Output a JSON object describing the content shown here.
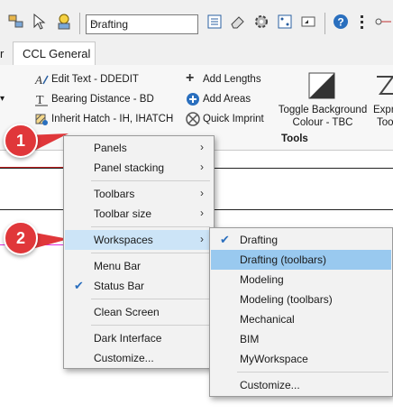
{
  "toolbar": {
    "workspace_value": "Drafting"
  },
  "tabs": [
    {
      "label": "r"
    },
    {
      "label": "CCL General"
    }
  ],
  "ribbon": {
    "col1": [
      "Edit Text - DDEDIT",
      "Bearing Distance - BD",
      "Inherit Hatch - IH, IHATCH"
    ],
    "col2": [
      "Add Lengths",
      "Add Areas",
      "Quick Imprint"
    ],
    "toggle_label_1": "Toggle Background",
    "toggle_label_2": "Colour - TBC",
    "expr_label_1": "Expr",
    "expr_label_2": "Too",
    "group_label": "Tools"
  },
  "callouts": [
    "1",
    "2"
  ],
  "context_menu": {
    "items": [
      {
        "label": "Panels",
        "submenu": true
      },
      {
        "label": "Panel stacking",
        "submenu": true
      },
      {
        "label": "Toolbars",
        "submenu": true
      },
      {
        "label": "Toolbar size",
        "submenu": true
      },
      {
        "label": "Workspaces",
        "submenu": true
      },
      {
        "label": "Menu Bar"
      },
      {
        "label": "Status Bar",
        "checked": true
      },
      {
        "label": "Clean Screen"
      },
      {
        "label": "Dark Interface"
      },
      {
        "label": "Customize..."
      }
    ]
  },
  "workspaces_menu": {
    "items": [
      {
        "label": "Drafting",
        "checked": true
      },
      {
        "label": "Drafting (toolbars)"
      },
      {
        "label": "Modeling"
      },
      {
        "label": "Modeling (toolbars)"
      },
      {
        "label": "Mechanical"
      },
      {
        "label": "BIM"
      },
      {
        "label": "MyWorkspace"
      },
      {
        "label": "Customize..."
      }
    ]
  },
  "colors": {
    "callout": "#e0373a",
    "highlight": "#cce4f7",
    "selected": "#99c9ef",
    "accent_line": "#e030e0",
    "check": "#2a6fbe"
  }
}
